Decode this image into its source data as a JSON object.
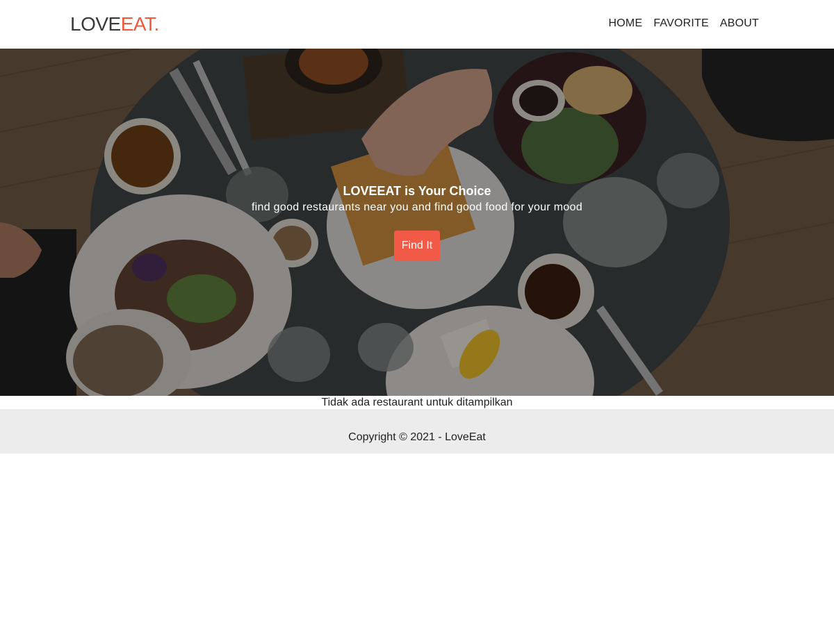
{
  "header": {
    "logo_love": "LOVE",
    "logo_eat": "EAT.",
    "nav": [
      "HOME",
      "FAVORITE",
      "ABOUT"
    ]
  },
  "hero": {
    "title": "LOVEEAT is Your Choice",
    "subtitle": "find good restaurants near you and find good food for your mood",
    "button_label": "Find It"
  },
  "main": {
    "empty_message": "Tidak ada restaurant untuk ditampilkan"
  },
  "footer": {
    "copyright": "Copyright © 2021 - LoveEat"
  },
  "colors": {
    "accent": "#f05a47",
    "footer_bg": "#ececec"
  }
}
